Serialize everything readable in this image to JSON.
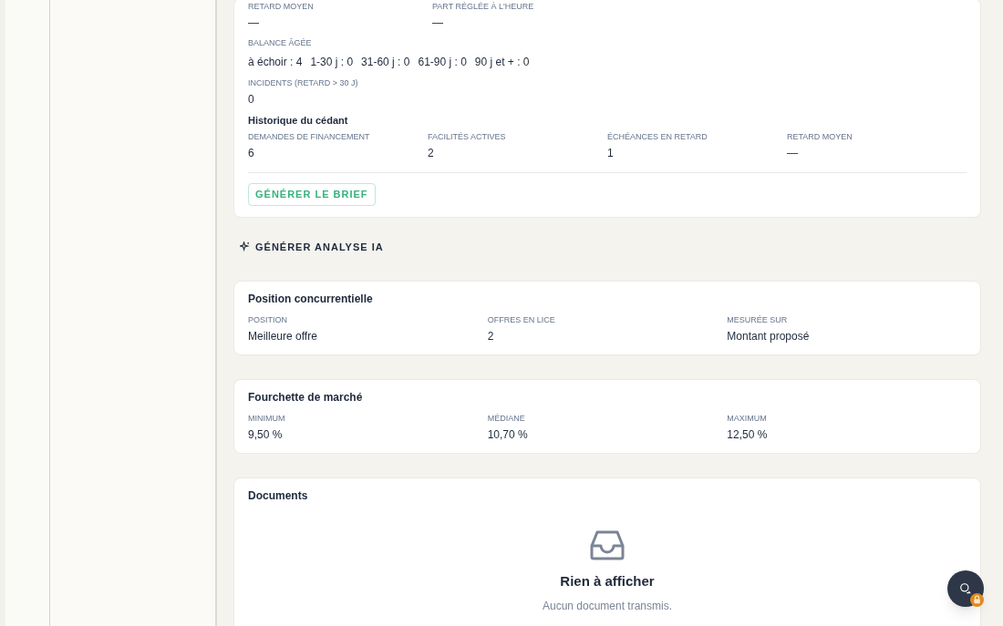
{
  "payment_card": {
    "top_fields": [
      {
        "label": "RETARD MOYEN",
        "value": "—"
      },
      {
        "label": "PART RÉGLÉE À L'HEURE",
        "value": "—"
      }
    ],
    "aged_balance": {
      "label": "BALANCE ÂGÉE",
      "buckets": [
        "à échoir : 4",
        "1-30 j : 0",
        "31-60 j : 0",
        "61-90 j : 0",
        "90 j et + : 0"
      ]
    },
    "incidents": {
      "label": "INCIDENTS (RETARD > 30 J)",
      "value": "0"
    },
    "history": {
      "title": "Historique du cédant",
      "fields": [
        {
          "label": "DEMANDES DE FINANCEMENT",
          "value": "6"
        },
        {
          "label": "FACILITÉS ACTIVES",
          "value": "2"
        },
        {
          "label": "ÉCHÉANCES EN RETARD",
          "value": "1"
        },
        {
          "label": "RETARD MOYEN",
          "value": "—"
        }
      ]
    },
    "brief_button": "GÉNÉRER LE BRIEF"
  },
  "ai_button": "GÉNÉRER ANALYSE IA",
  "sections": [
    {
      "title": "Position concurrentielle",
      "fields": [
        {
          "label": "POSITION",
          "value": "Meilleure offre"
        },
        {
          "label": "OFFRES EN LICE",
          "value": "2"
        },
        {
          "label": "MESURÉE SUR",
          "value": "Montant proposé"
        }
      ]
    },
    {
      "title": "Fourchette de marché",
      "fields": [
        {
          "label": "MINIMUM",
          "value": "9,50 %"
        },
        {
          "label": "MÉDIANE",
          "value": "10,70 %"
        },
        {
          "label": "MAXIMUM",
          "value": "12,50 %"
        }
      ]
    }
  ],
  "documents": {
    "title": "Documents",
    "empty_title": "Rien à afficher",
    "empty_text": "Aucun document transmis."
  }
}
